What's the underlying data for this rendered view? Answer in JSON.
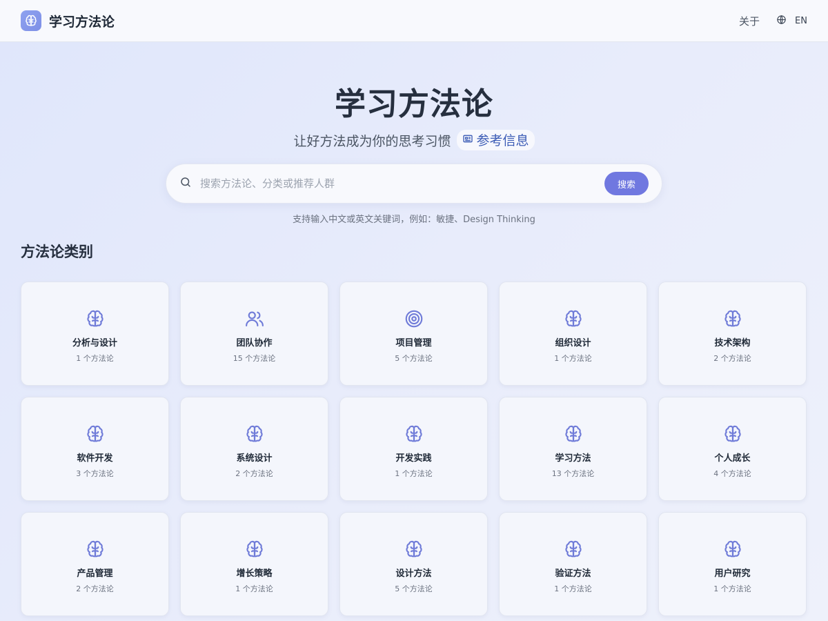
{
  "header": {
    "brand_name": "学习方法论",
    "about_label": "关于",
    "lang_label": "EN"
  },
  "hero": {
    "title": "学习方法论",
    "subtitle": "让好方法成为你的思考习惯",
    "ref_label": "参考信息"
  },
  "search": {
    "placeholder": "搜索方法论、分类或推荐人群",
    "button_label": "搜索",
    "hint": "支持输入中文或英文关键词，例如：敏捷、Design Thinking"
  },
  "section": {
    "title": "方法论类别"
  },
  "colors": {
    "accent": "#7078e0",
    "icon": "#6f7bd8"
  },
  "categories": [
    {
      "name": "分析与设计",
      "count": "1 个方法论",
      "icon": "brain-icon"
    },
    {
      "name": "团队协作",
      "count": "15 个方法论",
      "icon": "users-icon"
    },
    {
      "name": "项目管理",
      "count": "5 个方法论",
      "icon": "target-icon"
    },
    {
      "name": "组织设计",
      "count": "1 个方法论",
      "icon": "brain-icon"
    },
    {
      "name": "技术架构",
      "count": "2 个方法论",
      "icon": "brain-icon"
    },
    {
      "name": "软件开发",
      "count": "3 个方法论",
      "icon": "brain-icon"
    },
    {
      "name": "系统设计",
      "count": "2 个方法论",
      "icon": "brain-icon"
    },
    {
      "name": "开发实践",
      "count": "1 个方法论",
      "icon": "brain-icon"
    },
    {
      "name": "学习方法",
      "count": "13 个方法论",
      "icon": "brain-icon"
    },
    {
      "name": "个人成长",
      "count": "4 个方法论",
      "icon": "brain-icon"
    },
    {
      "name": "产品管理",
      "count": "2 个方法论",
      "icon": "brain-icon"
    },
    {
      "name": "增长策略",
      "count": "1 个方法论",
      "icon": "brain-icon"
    },
    {
      "name": "设计方法",
      "count": "5 个方法论",
      "icon": "brain-icon"
    },
    {
      "name": "验证方法",
      "count": "1 个方法论",
      "icon": "brain-icon"
    },
    {
      "name": "用户研究",
      "count": "1 个方法论",
      "icon": "brain-icon"
    }
  ]
}
